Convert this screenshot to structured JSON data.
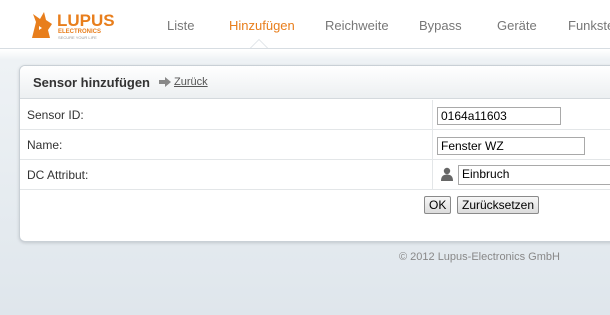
{
  "brand": {
    "logo_main": "LUPUS",
    "logo_sub": "ELECTRONICS",
    "logo_tagline": "SECURE YOUR LIFE",
    "accent_color": "#e87e1c"
  },
  "nav": {
    "items": [
      {
        "label": "Liste",
        "active": false
      },
      {
        "label": "Hinzufügen",
        "active": true
      },
      {
        "label": "Reichweite",
        "active": false
      },
      {
        "label": "Bypass",
        "active": false
      },
      {
        "label": "Geräte",
        "active": false
      },
      {
        "label": "Funkste",
        "active": false
      }
    ]
  },
  "panel": {
    "title": "Sensor hinzufügen",
    "back_label": "Zurück",
    "back_icon": "arrow-right-icon",
    "rows": [
      {
        "label": "Sensor ID:",
        "value": "0164a11603"
      },
      {
        "label": "Name:",
        "value": "Fenster WZ"
      },
      {
        "label": "DC Attribut:",
        "value": "Einbruch",
        "icon": "user-icon"
      }
    ],
    "ok_label": "OK",
    "reset_label": "Zurücksetzen"
  },
  "footer": {
    "copyright": "© 2012 Lupus-Electronics GmbH"
  }
}
